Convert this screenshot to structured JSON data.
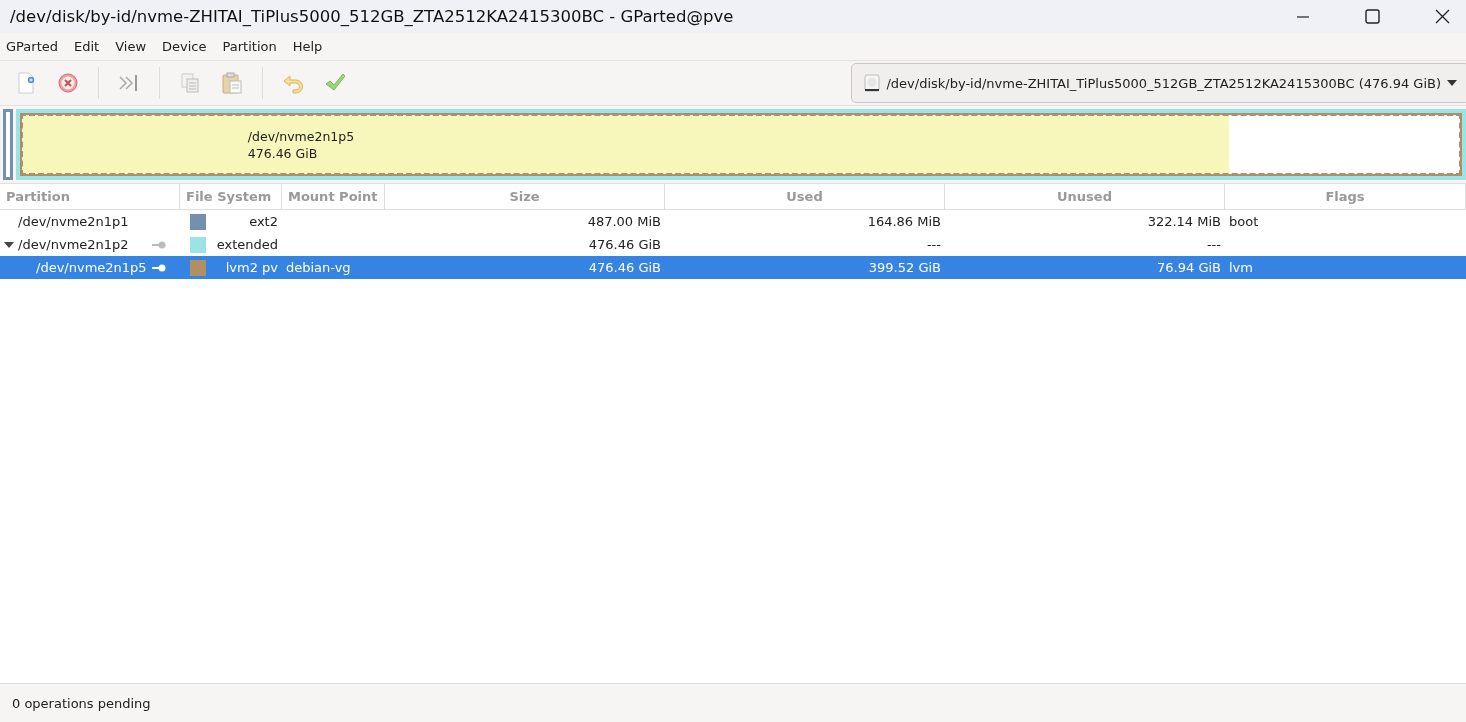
{
  "window": {
    "title": "/dev/disk/by-id/nvme-ZHITAI_TiPlus5000_512GB_ZTA2512KA2415300BC - GParted@pve"
  },
  "menu": [
    "GParted",
    "Edit",
    "View",
    "Device",
    "Partition",
    "Help"
  ],
  "device_selector": {
    "value": "/dev/disk/by-id/nvme-ZHITAI_TiPlus5000_512GB_ZTA2512KA2415300BC (476.94 GiB)"
  },
  "disk_map": {
    "label": "/dev/nvme2n1p5",
    "size": "476.46 GiB",
    "level": 0.84
  },
  "table": {
    "columns": [
      "Partition",
      "File System",
      "Mount Point",
      "Size",
      "Used",
      "Unused",
      "Flags"
    ],
    "rows": [
      {
        "partition": "/dev/nvme2n1p1",
        "busy": false,
        "color": "#7590ae",
        "file_system": "ext2",
        "size": "487.00 MiB",
        "used": "164.86 MiB",
        "unused": "322.14 MiB",
        "flags": "boot",
        "selected": false
      },
      {
        "partition": "/dev/nvme2n1p2",
        "busy": true,
        "color": "#9be3e6",
        "file_system": "extended",
        "size": "476.46 GiB",
        "used": "---",
        "unused": "---",
        "selected": false,
        "expanded": true,
        "children": [
          {
            "partition": "/dev/nvme2n1p5",
            "busy": true,
            "color": "#b08f63",
            "file_system": "lvm2 pv",
            "mount_point": "debian-vg",
            "size": "476.46 GiB",
            "used": "399.52 GiB",
            "unused": "76.94 GiB",
            "flags": "lvm",
            "selected": true
          }
        ]
      }
    ]
  },
  "status_bar": "0 operations pending"
}
